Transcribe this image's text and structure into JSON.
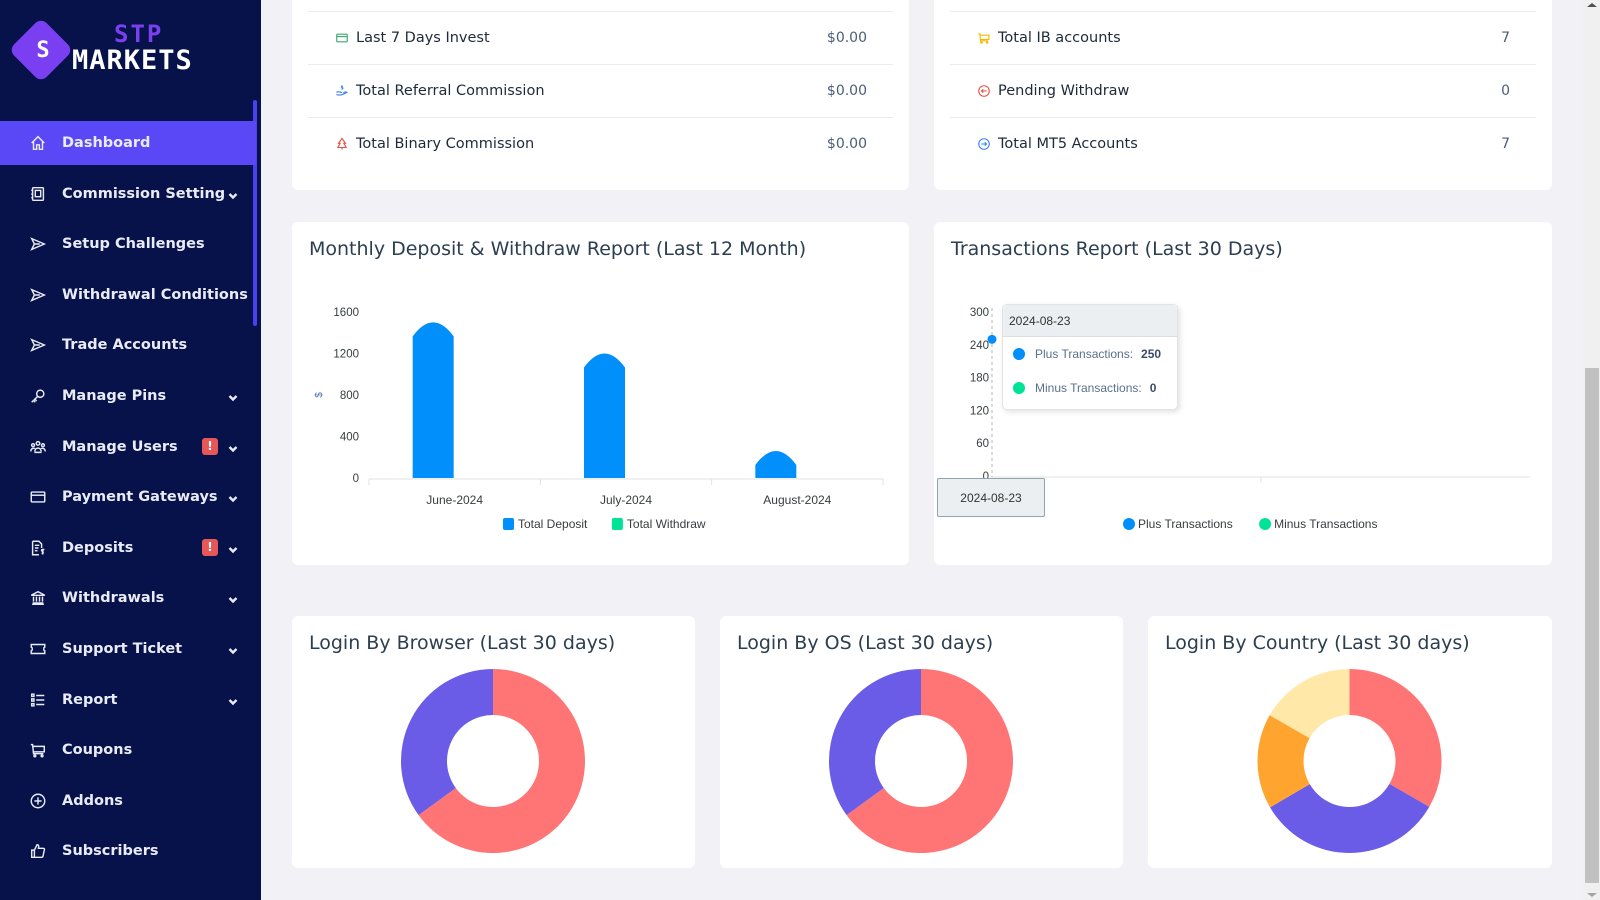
{
  "brand": {
    "name_top": "STP",
    "name_bottom": "MARKETS",
    "monogram": "S"
  },
  "sidebar": {
    "items": [
      {
        "label": "Dashboard",
        "icon": "home-icon",
        "active": true,
        "chevron": false,
        "badge": null
      },
      {
        "label": "Commission Setting",
        "icon": "contact-card-icon",
        "chevron": true,
        "badge": null
      },
      {
        "label": "Setup Challenges",
        "icon": "send-icon",
        "chevron": false,
        "badge": null
      },
      {
        "label": "Withdrawal Conditions",
        "icon": "send-icon",
        "chevron": false,
        "badge": null
      },
      {
        "label": "Trade Accounts",
        "icon": "send-icon",
        "chevron": false,
        "badge": null
      },
      {
        "label": "Manage Pins",
        "icon": "key-icon",
        "chevron": true,
        "badge": null
      },
      {
        "label": "Manage Users",
        "icon": "users-icon",
        "chevron": true,
        "badge": "!"
      },
      {
        "label": "Payment Gateways",
        "icon": "credit-card-icon",
        "chevron": true,
        "badge": null
      },
      {
        "label": "Deposits",
        "icon": "invoice-dollar-icon",
        "chevron": true,
        "badge": "!"
      },
      {
        "label": "Withdrawals",
        "icon": "bank-icon",
        "chevron": true,
        "badge": null
      },
      {
        "label": "Support Ticket",
        "icon": "ticket-icon",
        "chevron": true,
        "badge": null
      },
      {
        "label": "Report",
        "icon": "list-icon",
        "chevron": true,
        "badge": null
      },
      {
        "label": "Coupons",
        "icon": "cart-icon",
        "chevron": false,
        "badge": null
      },
      {
        "label": "Addons",
        "icon": "plus-circle-icon",
        "chevron": false,
        "badge": null
      },
      {
        "label": "Subscribers",
        "icon": "thumbs-up-icon",
        "chevron": false,
        "badge": null
      }
    ]
  },
  "stats_left": [
    {
      "label": "Last 7 Days Invest",
      "value": "$0.00",
      "icon": "credit-card-icon",
      "color": "#3aa76d"
    },
    {
      "label": "Total Referral Commission",
      "value": "$0.00",
      "icon": "hand-dollar-icon",
      "color": "#3b82f6"
    },
    {
      "label": "Total Binary Commission",
      "value": "$0.00",
      "icon": "tree-icon",
      "color": "#e5534b"
    }
  ],
  "stats_right": [
    {
      "label": "Total IB accounts",
      "value": "7",
      "icon": "cart-icon",
      "color": "#f5b800"
    },
    {
      "label": "Pending Withdraw",
      "value": "0",
      "icon": "arrow-left-circle-icon",
      "color": "#e5534b"
    },
    {
      "label": "Total MT5 Accounts",
      "value": "7",
      "icon": "arrow-right-circle-icon",
      "color": "#3b82f6"
    }
  ],
  "monthly": {
    "title": "Monthly Deposit & Withdraw Report (Last 12 Month)",
    "ylabel_symbol": "$"
  },
  "transactions": {
    "title": "Transactions Report (Last 30 Days)",
    "tooltip": {
      "date": "2024-08-23",
      "rows": [
        {
          "label": "Plus Transactions:",
          "value": "250",
          "color": "#008ffb"
        },
        {
          "label": "Minus Transactions:",
          "value": "0",
          "color": "#00e396"
        }
      ]
    },
    "x_tooltip": "2024-08-23"
  },
  "donuts": {
    "browser": {
      "title": "Login By Browser (Last 30 days)"
    },
    "os": {
      "title": "Login By OS (Last 30 days)"
    },
    "country": {
      "title": "Login By Country (Last 30 days)"
    }
  },
  "chart_data": [
    {
      "type": "bar",
      "title": "Monthly Deposit & Withdraw Report (Last 12 Month)",
      "categories": [
        "June-2024",
        "July-2024",
        "August-2024"
      ],
      "series": [
        {
          "name": "Total Deposit",
          "color": "#008ffb",
          "values": [
            1500,
            1200,
            260
          ]
        },
        {
          "name": "Total Withdraw",
          "color": "#00e396",
          "values": [
            0,
            0,
            0
          ]
        }
      ],
      "xlabel": "",
      "ylabel": "$",
      "yticks": [
        0,
        400,
        800,
        1200,
        1600
      ],
      "ylim": [
        0,
        1600
      ],
      "legend": "bottom-center"
    },
    {
      "type": "line",
      "title": "Transactions Report (Last 30 Days)",
      "x": [
        "2024-08-23"
      ],
      "series": [
        {
          "name": "Plus Transactions",
          "color": "#008ffb",
          "values": [
            250
          ]
        },
        {
          "name": "Minus Transactions",
          "color": "#00e396",
          "values": [
            0
          ]
        }
      ],
      "yticks": [
        0,
        60,
        120,
        180,
        240,
        300
      ],
      "ylim": [
        0,
        300
      ],
      "legend": "bottom-center"
    },
    {
      "type": "pie",
      "title": "Login By Browser (Last 30 days)",
      "slices": [
        {
          "value": 65,
          "color": "#ff7575"
        },
        {
          "value": 35,
          "color": "#6b5ce7"
        }
      ]
    },
    {
      "type": "pie",
      "title": "Login By OS (Last 30 days)",
      "slices": [
        {
          "value": 65,
          "color": "#ff7575"
        },
        {
          "value": 35,
          "color": "#6b5ce7"
        }
      ]
    },
    {
      "type": "pie",
      "title": "Login By Country (Last 30 days)",
      "slices": [
        {
          "value": 33.3,
          "color": "#ff7575"
        },
        {
          "value": 33.3,
          "color": "#6b5ce7"
        },
        {
          "value": 16.7,
          "color": "#ffa52f"
        },
        {
          "value": 16.7,
          "color": "#ffe8a8"
        }
      ]
    }
  ]
}
